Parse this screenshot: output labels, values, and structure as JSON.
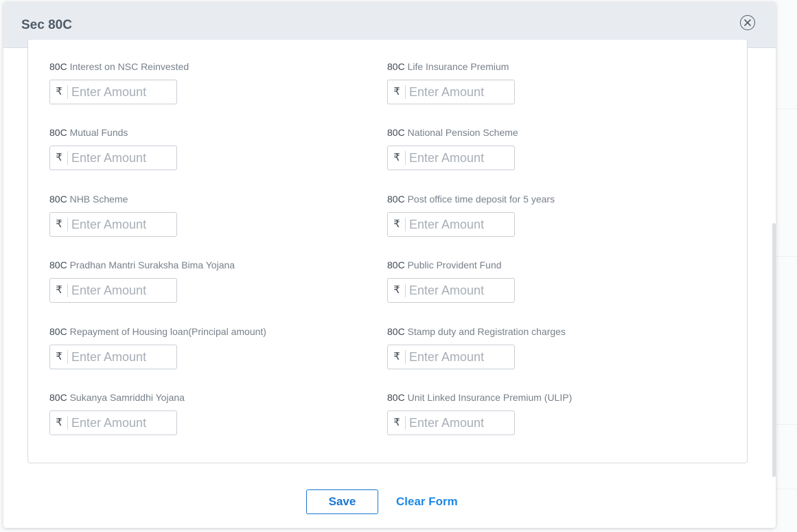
{
  "modal": {
    "title": "Sec 80C",
    "close_icon": "circle-x-icon"
  },
  "currency_symbol": "₹",
  "amount_placeholder": "Enter Amount",
  "fields": [
    {
      "prefix": "80C",
      "label": "Interest on NSC Reinvested",
      "value": ""
    },
    {
      "prefix": "80C",
      "label": "Life Insurance Premium",
      "value": ""
    },
    {
      "prefix": "80C",
      "label": "Mutual Funds",
      "value": ""
    },
    {
      "prefix": "80C",
      "label": "National Pension Scheme",
      "value": ""
    },
    {
      "prefix": "80C",
      "label": "NHB Scheme",
      "value": ""
    },
    {
      "prefix": "80C",
      "label": "Post office time deposit for 5 years",
      "value": ""
    },
    {
      "prefix": "80C",
      "label": "Pradhan Mantri Suraksha Bima Yojana",
      "value": ""
    },
    {
      "prefix": "80C",
      "label": "Public Provident Fund",
      "value": ""
    },
    {
      "prefix": "80C",
      "label": "Repayment of Housing loan(Principal amount)",
      "value": ""
    },
    {
      "prefix": "80C",
      "label": "Stamp duty and Registration charges",
      "value": ""
    },
    {
      "prefix": "80C",
      "label": "Sukanya Samriddhi Yojana",
      "value": ""
    },
    {
      "prefix": "80C",
      "label": "Unit Linked Insurance Premium (ULIP)",
      "value": ""
    }
  ],
  "footer": {
    "save_label": "Save",
    "clear_label": "Clear Form"
  },
  "colors": {
    "accent": "#1976d2",
    "header_bg": "#e8ecf1"
  }
}
